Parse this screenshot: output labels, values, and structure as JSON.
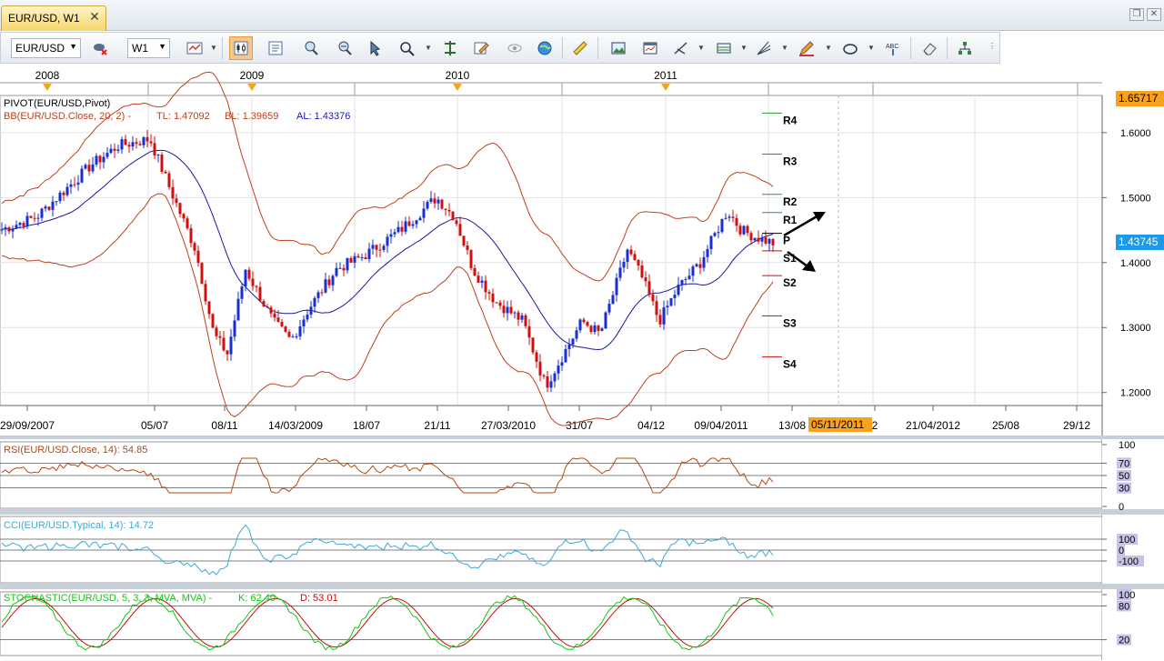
{
  "tab": {
    "title": "EUR/USD, W1",
    "close": "✕"
  },
  "window": {
    "restore": "❐",
    "close": "✕"
  },
  "toolbar": {
    "symbol": "EUR/USD",
    "timeframe": "W1"
  },
  "timeline": {
    "years": [
      "2008",
      "2009",
      "2010",
      "2011"
    ]
  },
  "price_axis": {
    "ticks": [
      "1.6000",
      "1.5000",
      "1.4000",
      "1.3000",
      "1.2000"
    ],
    "top_badge": "1.65717",
    "current_badge": "1.43745"
  },
  "date_axis": {
    "ticks": [
      "29/09/2007",
      "05/07",
      "08/11",
      "14/03/2009",
      "18/07",
      "21/11",
      "27/03/2010",
      "31/07",
      "04/12",
      "09/04/2011",
      "13/08",
      "2",
      "21/04/2012",
      "25/08",
      "29/12"
    ],
    "cursor_date": "05/11/2011"
  },
  "indicators": {
    "pivot": "PIVOT(EUR/USD,Pivot)",
    "bb": "BB(EUR/USD.Close, 20, 2) -",
    "bb_tl": "TL: 1.47092",
    "bb_bl": "BL: 1.39659",
    "bb_al": "AL: 1.43376",
    "rsi": "RSI(EUR/USD.Close, 14): 54.85",
    "cci": "CCI(EUR/USD.Typical, 14): 14.72",
    "stoch": "STOCHASTIC(EUR/USD, 5, 3, 3, MVA, MVA) -",
    "stoch_k": "K: 62.40",
    "stoch_d": "D: 53.01"
  },
  "pivot_levels": [
    "R4",
    "R3",
    "R2",
    "R1",
    "P",
    "S1",
    "S2",
    "S3",
    "S4"
  ],
  "rsi_axis": [
    "100",
    "70",
    "50",
    "30",
    "0"
  ],
  "cci_axis": [
    "100",
    "0",
    "-100"
  ],
  "stoch_axis": [
    "100",
    "80",
    "20"
  ],
  "colors": {
    "bull": "#1a2fd0",
    "bear": "#d01010",
    "bb": "#c0401a",
    "ma": "#1a1aa0",
    "rsi": "#b8460f",
    "cci": "#3aaad8",
    "stoch_k": "#16c416",
    "stoch_d": "#c01010",
    "badge": "#f9a11b"
  }
}
